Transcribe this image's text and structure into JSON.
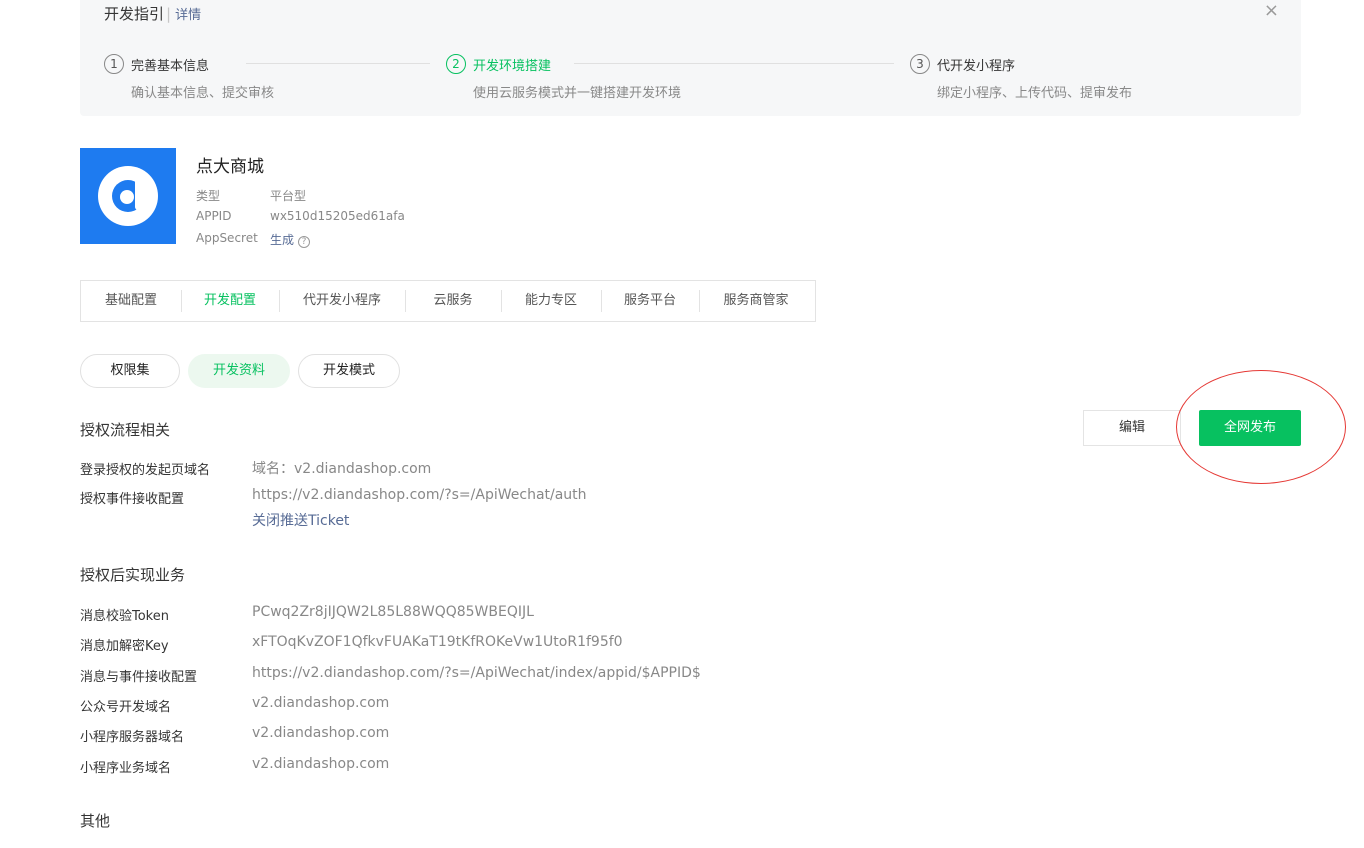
{
  "guide": {
    "title": "开发指引",
    "separator": "|",
    "detail_link": "详情",
    "close_icon": "×",
    "steps": [
      {
        "num": "1",
        "title": "完善基本信息",
        "desc": "确认基本信息、提交审核",
        "active": false
      },
      {
        "num": "2",
        "title": "开发环境搭建",
        "desc": "使用云服务模式并一键搭建开发环境",
        "active": true
      },
      {
        "num": "3",
        "title": "代开发小程序",
        "desc": "绑定小程序、上传代码、提审发布",
        "active": false
      }
    ]
  },
  "app": {
    "logo_icon": "d-logo-icon",
    "name": "点大商城",
    "type_label": "类型",
    "type_value": "平台型",
    "appid_label": "APPID",
    "appid_value": "wx510d15205ed61afa",
    "secret_label": "AppSecret",
    "secret_action": "生成",
    "help_icon": "?"
  },
  "tabs": [
    "基础配置",
    "开发配置",
    "代开发小程序",
    "云服务",
    "能力专区",
    "服务平台",
    "服务商管家"
  ],
  "active_tab": "开发配置",
  "pills": [
    "权限集",
    "开发资料",
    "开发模式"
  ],
  "active_pill": "开发资料",
  "auth_section": {
    "title": "授权流程相关",
    "edit_button": "编辑",
    "publish_button": "全网发布",
    "rows": [
      {
        "label": "登录授权的发起页域名",
        "value": "域名：v2.diandashop.com"
      },
      {
        "label": "授权事件接收配置",
        "value": "https://v2.diandashop.com/?s=/ApiWechat/auth",
        "link": "关闭推送Ticket"
      }
    ]
  },
  "business_section": {
    "title": "授权后实现业务",
    "rows": [
      {
        "label": "消息校验Token",
        "value": "PCwq2Zr8jIJQW2L85L88WQQ85WBEQIJL"
      },
      {
        "label": "消息加解密Key",
        "value": "xFTOqKvZOF1QfkvFUAKaT19tKfROKeVw1UtoR1f95f0"
      },
      {
        "label": "消息与事件接收配置",
        "value": "https://v2.diandashop.com/?s=/ApiWechat/index/appid/$APPID$"
      },
      {
        "label": "公众号开发域名",
        "value": "v2.diandashop.com"
      },
      {
        "label": "小程序服务器域名",
        "value": "v2.diandashop.com"
      },
      {
        "label": "小程序业务域名",
        "value": "v2.diandashop.com"
      }
    ]
  },
  "other_section": {
    "title": "其他"
  },
  "colors": {
    "accent": "#07c160",
    "link": "#576b95",
    "annotation": "#e53935"
  }
}
